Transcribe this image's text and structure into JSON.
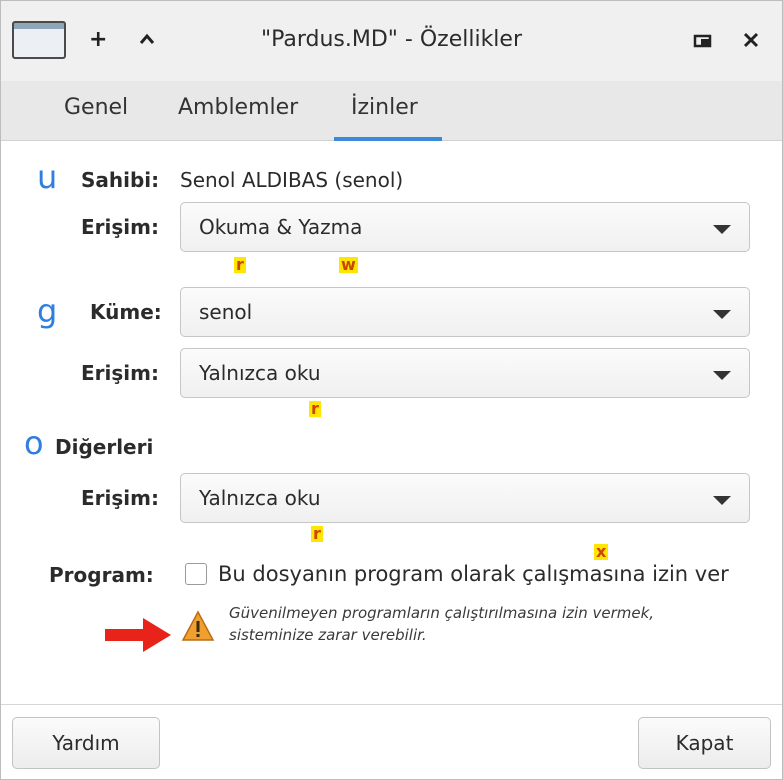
{
  "window": {
    "title": "\"Pardus.MD\" - Özellikler",
    "add_symbol": "+",
    "up_symbol": "^",
    "restore_symbol": "□",
    "close_symbol": "✕"
  },
  "tabs": [
    {
      "label": "Genel",
      "active": false
    },
    {
      "label": "Amblemler",
      "active": false
    },
    {
      "label": "İzinler",
      "active": true
    }
  ],
  "owner": {
    "marker": "u",
    "label": "Sahibi:",
    "value": "Senol ALDIBAS (senol)",
    "access_label": "Erişim:",
    "access_value": "Okuma & Yazma",
    "marks": [
      "r",
      "w"
    ]
  },
  "group": {
    "marker": "g",
    "label": "Küme:",
    "value": "senol",
    "access_label": "Erişim:",
    "access_value": "Yalnızca oku",
    "marks": [
      "r"
    ]
  },
  "others": {
    "marker": "o",
    "label": "Diğerleri",
    "access_label": "Erişim:",
    "access_value": "Yalnızca oku",
    "marks": [
      "r"
    ]
  },
  "program": {
    "label": "Program:",
    "checkbox_label": "Bu dosyanın program olarak çalışmasına izin ver",
    "checked": false,
    "mark": "x",
    "warning_line1": "Güvenilmeyen programların çalıştırılmasına izin vermek,",
    "warning_line2": "sisteminize zarar verebilir."
  },
  "buttons": {
    "help": "Yardım",
    "close": "Kapat"
  },
  "colors": {
    "accent": "#3a8ad9",
    "marker_blue": "#2f7fe0",
    "mark_highlight": "#ffe600",
    "arrow_red": "#e8231a",
    "warning_orange": "#f0a030"
  }
}
